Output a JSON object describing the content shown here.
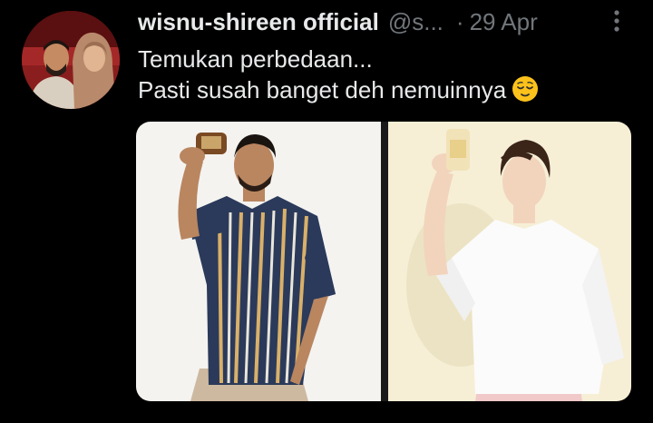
{
  "tweet": {
    "author_name": "wisnu-shireen official",
    "author_handle": "@s...",
    "separator": "·",
    "date": "29 Apr",
    "text_lines": [
      "Temukan perbedaan...",
      "Pasti susah banget deh nemuinnya"
    ],
    "emoji": "relieved-face",
    "more_icon": "more-vertical-icon",
    "media": [
      {
        "name": "photo-man-striped-shirt"
      },
      {
        "name": "photo-man-white-shirt"
      }
    ]
  },
  "colors": {
    "background": "#000000",
    "primary_text": "#e7e9ea",
    "secondary_text": "#71767b"
  }
}
